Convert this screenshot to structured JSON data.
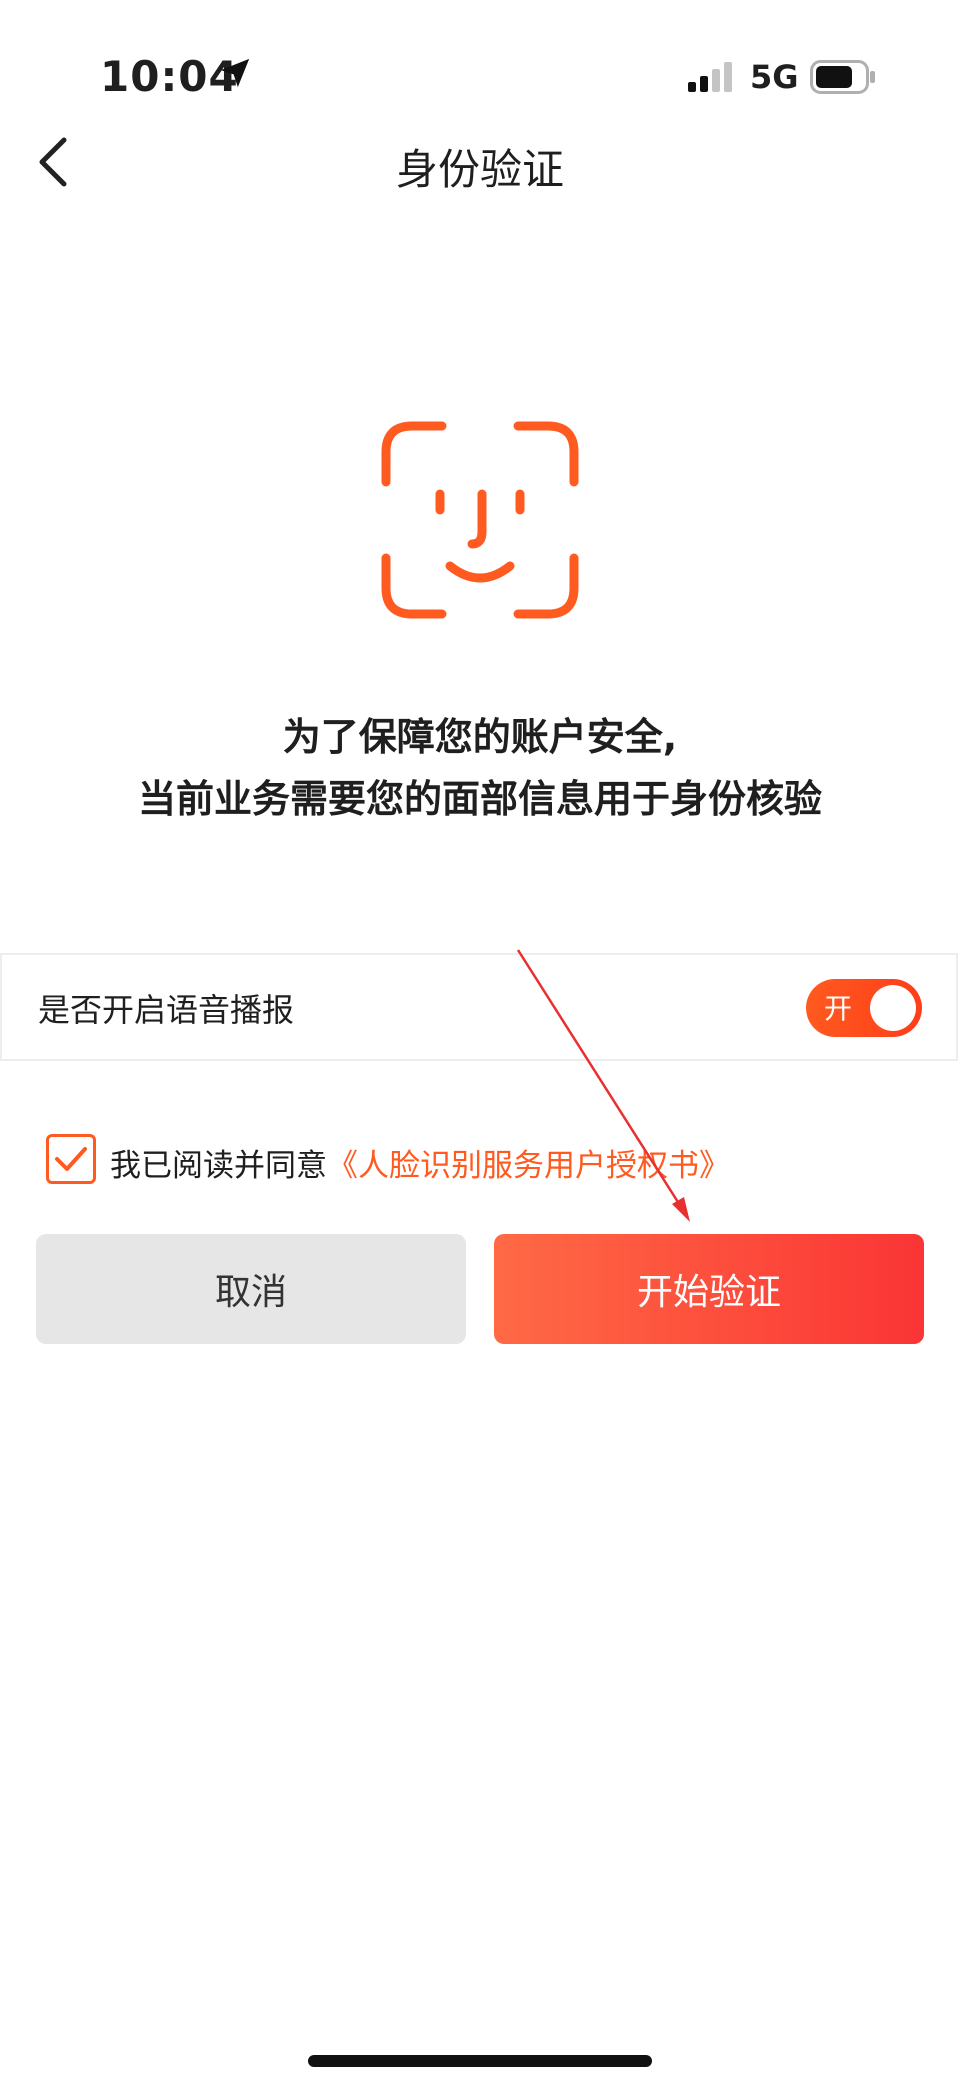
{
  "status_bar": {
    "time": "10:04",
    "network": "5G"
  },
  "header": {
    "title": "身份验证"
  },
  "description": {
    "line1": "为了保障您的账户安全,",
    "line2": "当前业务需要您的面部信息用于身份核验"
  },
  "voice": {
    "label": "是否开启语音播报",
    "toggle_label": "开",
    "enabled": true
  },
  "agreement": {
    "prefix": "我已阅读并同意",
    "link": "《人脸识别服务用户授权书》",
    "checked": true
  },
  "buttons": {
    "cancel": "取消",
    "start": "开始验证"
  },
  "colors": {
    "accent": "#ff5a1f",
    "start_gradient_end": "#fa3535",
    "cancel_bg": "#e6e6e6",
    "arrow": "#e83030"
  }
}
